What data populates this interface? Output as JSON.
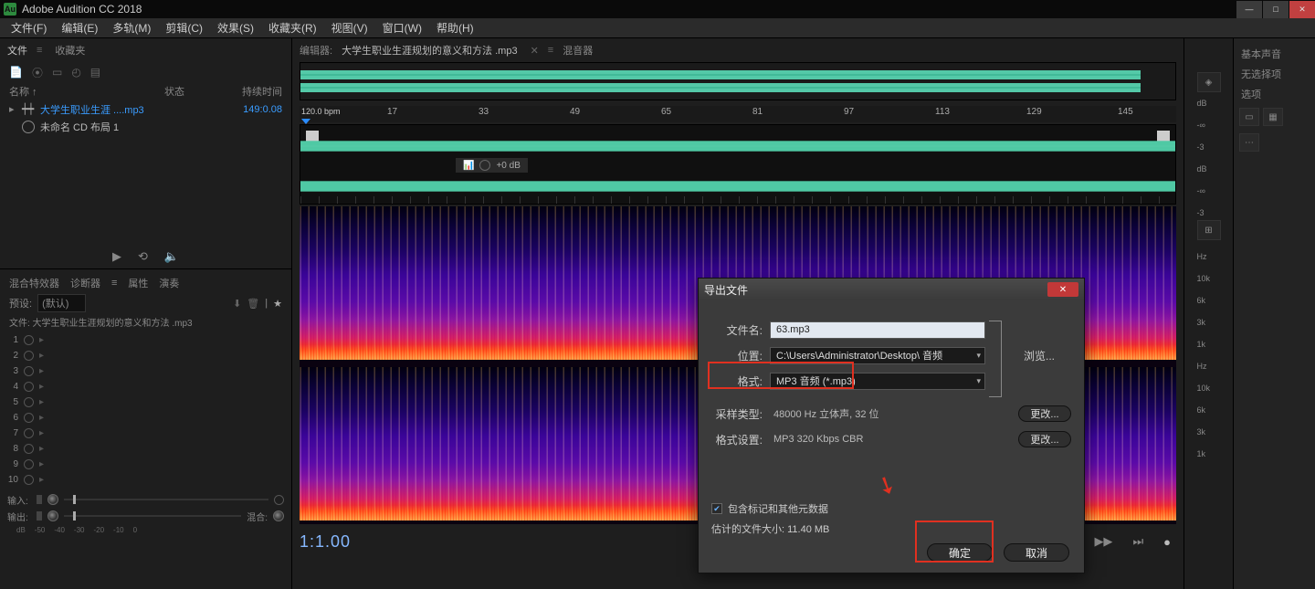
{
  "titlebar": {
    "app_icon_text": "Au",
    "title": "Adobe Audition CC 2018"
  },
  "menubar": {
    "file": "文件(F)",
    "edit": "编辑(E)",
    "multitrack": "多轨(M)",
    "clip": "剪辑(C)",
    "effects": "效果(S)",
    "favorites": "收藏夹(R)",
    "view": "视图(V)",
    "window": "窗口(W)",
    "help": "帮助(H)"
  },
  "left_panel": {
    "tab_files": "文件",
    "tab_favorites": "收藏夹",
    "header_name": "名称 ↑",
    "header_status": "状态",
    "header_duration": "持续时间",
    "files": [
      {
        "name": "大学生职业生涯 ....mp3",
        "duration": "149:0.08",
        "selected": true,
        "type": "wave"
      },
      {
        "name": "未命名 CD 布局 1",
        "duration": "",
        "selected": false,
        "type": "cd"
      }
    ],
    "effects": {
      "tab_rack": "混合特效器",
      "tab_marker": "诊断器",
      "tab_attr": "属性",
      "tab_more": "演奏",
      "preset_label": "预设:",
      "preset_value": "(默认)",
      "file_line": "文件: 大学生职业生涯规划的意义和方法 .mp3",
      "slots": [
        "1",
        "2",
        "3",
        "4",
        "5",
        "6",
        "7",
        "8",
        "9",
        "10"
      ],
      "input_label": "输入:",
      "output_label": "输出:",
      "mix_label": "混合:",
      "scale": [
        "dB",
        "-50",
        "-40",
        "-30",
        "-20",
        "-10",
        "0"
      ]
    }
  },
  "editor": {
    "tab_editor": "编辑器:",
    "tab_filename": "大学生职业生涯规划的意义和方法 .mp3",
    "tab_mixer": "混音器",
    "bpm_label": "120.0 bpm",
    "ticks": [
      "17",
      "33",
      "49",
      "65",
      "81",
      "97",
      "113",
      "129",
      "145"
    ],
    "region_gain": "+0 dB",
    "db_top": "dB",
    "db_inf": "-∞",
    "db_m3": "-3",
    "hz_label": "Hz",
    "hz_10k": "10k",
    "hz_6k": "6k",
    "hz_3k": "3k",
    "hz_1k": "1k",
    "time": "1:1.00"
  },
  "right_panel": {
    "header": "基本声音",
    "sub1": "无选择项",
    "sub2": "选项"
  },
  "dialog": {
    "title": "导出文件",
    "filename_label": "文件名:",
    "filename_value": "63.mp3",
    "location_label": "位置:",
    "location_value": "C:\\Users\\Administrator\\Desktop\\ 音频",
    "format_label": "格式:",
    "format_value": "MP3 音频 (*.mp3)",
    "sample_label": "采样类型:",
    "sample_value": "48000 Hz 立体声, 32 位",
    "fmtset_label": "格式设置:",
    "fmtset_value": "MP3 320 Kbps CBR",
    "browse_btn": "浏览...",
    "change_btn": "更改...",
    "checkbox_label": "包含标记和其他元数据",
    "estimate_label": "估计的文件大小: 11.40 MB",
    "ok_btn": "确定",
    "cancel_btn": "取消"
  }
}
